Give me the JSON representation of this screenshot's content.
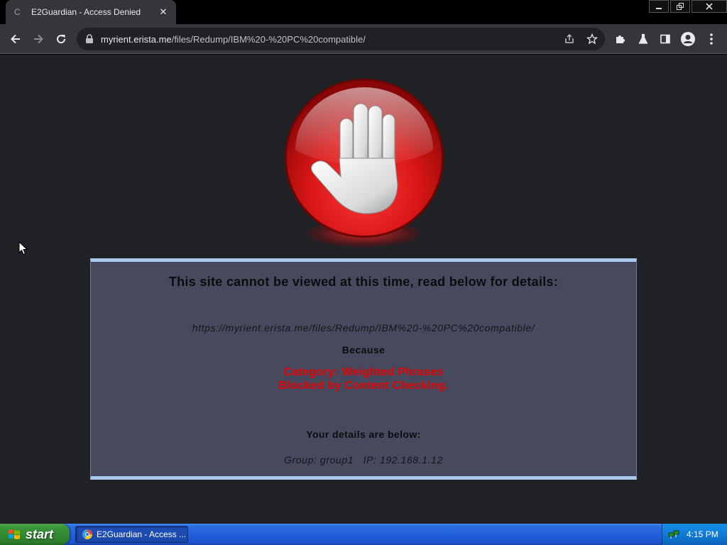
{
  "browser": {
    "tab": {
      "title": "E2Guardian - Access Denied",
      "close_glyph": "✕"
    },
    "window_controls": {
      "minimize": "—",
      "restore": "❐",
      "close": "✕"
    },
    "address_bar": {
      "url_host": "myrient.erista.me",
      "url_path": "/files/Redump/IBM%20-%20PC%20compatible/"
    }
  },
  "page": {
    "heading": "This site cannot be viewed at this time, read below for details:",
    "blocked_url": "https://myrient.erista.me/files/Redump/IBM%20-%20PC%20compatible/",
    "because_label": "Because",
    "reason_category": "Category: Weighted Phrases",
    "reason_detail": "Blocked by Content Checking.",
    "details_heading": "Your details are below:",
    "details_line": "Group: group1   IP: 192.168.1.12",
    "colors": {
      "background": "#1f2125",
      "box": "#474a5e",
      "box_border": "#a9c9ee",
      "reason": "#e60000",
      "stop_sign": "#d81616"
    },
    "icons": [
      "stop-hand-icon"
    ]
  },
  "taskbar": {
    "start_label": "start",
    "task_button_label": "E2Guardian - Access ...",
    "clock": "4:15 PM"
  }
}
